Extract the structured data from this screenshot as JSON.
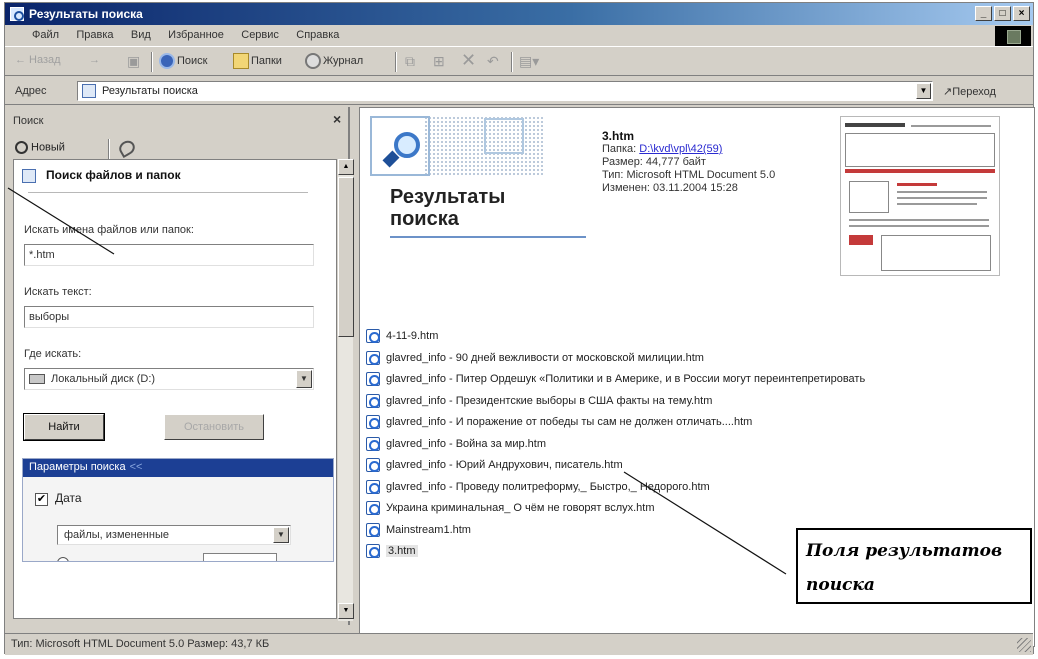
{
  "window": {
    "title": "Результаты поиска",
    "controls": [
      "_",
      "□",
      "×"
    ]
  },
  "menu": {
    "items": [
      "Файл",
      "Правка",
      "Вид",
      "Избранное",
      "Сервис",
      "Справка"
    ]
  },
  "toolbar": {
    "back": "← Назад",
    "forward": "→",
    "search": "Поиск",
    "folders": "Папки",
    "history": "Журнал"
  },
  "address": {
    "label": "Адрес",
    "value": "Результаты поиска",
    "go": "Переход"
  },
  "search_pane": {
    "title": "Поиск",
    "close": "×",
    "new_label": "Новый",
    "heading": "Поиск файлов и папок",
    "name_label": "Искать имена файлов или папок:",
    "name_value": "*.htm",
    "text_label": "Искать текст:",
    "text_value": "выборы",
    "where_label": "Где искать:",
    "where_value": "Локальный диск (D:)",
    "find_button": "Найти",
    "stop_button": "Остановить",
    "params_title": "Параметры поиска",
    "params_chevron": "<<",
    "date_label": "Дата",
    "date_checked": true,
    "date_filter": "файлы, измененные"
  },
  "banner": {
    "title_line1": "Результаты",
    "title_line2": "поиска"
  },
  "details": {
    "file_name": "3.htm",
    "folder_label": "Папка:",
    "folder_path": "D:\\kvd\\vpl\\42(59)",
    "size_text": "Размер: 44,777 байт",
    "type_text": "Тип: Microsoft HTML Document 5.0",
    "modified_text": "Изменен: 03.11.2004 15:28"
  },
  "results": [
    "4-11-9.htm",
    "glavred_info - 90 дней вежливости от московской милиции.htm",
    "glavred_info - Питер Ордешук «Политики и в Америке, и в России могут переинтепретировать",
    "glavred_info - Президентские выборы в США факты на тему.htm",
    "glavred_info - И поражение от победы ты сам не должен отличать....htm",
    "glavred_info - Война за мир.htm",
    "glavred_info - Юрий Андрухович, писатель.htm",
    "glavred_info - Проведу политреформу,_ Быстро,_ Недорого.htm",
    "Украина криминальная_ О чём не говорят вслух.htm",
    "Mainstream1.htm",
    "3.htm"
  ],
  "selected_result_index": 10,
  "callout": {
    "line1": "Поля результатов",
    "line2": "поиска"
  },
  "status": {
    "text": "Тип: Microsoft HTML Document 5.0 Размер: 43,7 КБ"
  },
  "colors": {
    "titlebar_start": "#0a246a",
    "params_header": "#1c3f94",
    "link": "#2a2ad0",
    "face": "#d4d0c8"
  }
}
